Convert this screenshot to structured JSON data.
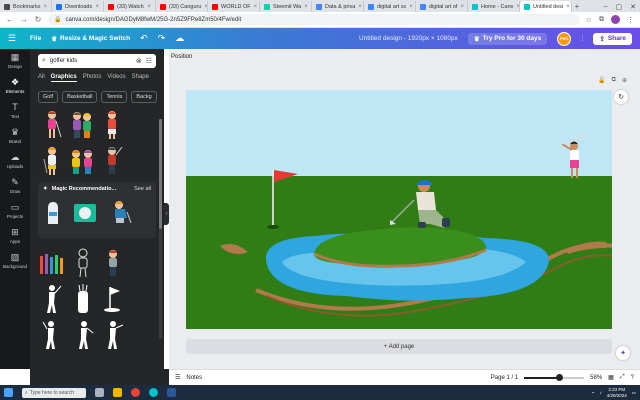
{
  "browser": {
    "tabs": [
      {
        "label": "Bookmarks",
        "color": "#4a4a4a"
      },
      {
        "label": "Downloads",
        "color": "#1a73e8"
      },
      {
        "label": "(33) Watch",
        "color": "#ff0000"
      },
      {
        "label": "(33) Canguru",
        "color": "#ff0000"
      },
      {
        "label": "WORLD OF",
        "color": "#ff0000"
      },
      {
        "label": "Steemit Wa",
        "color": "#06d6a9"
      },
      {
        "label": "Data & priva",
        "color": "#4285f4"
      },
      {
        "label": "digital art sc",
        "color": "#4285f4"
      },
      {
        "label": "digital art of",
        "color": "#4285f4"
      },
      {
        "label": "Home - Canv",
        "color": "#00c4cc"
      },
      {
        "label": "Untitled desi",
        "color": "#00c4cc",
        "active": true
      }
    ],
    "url": "canva.com/design/DAGDyM8fwM/25G-2n5Z9FPe8Zm50/4Fw/edit"
  },
  "header": {
    "file_label": "File",
    "resize_label": "Resize & Magic Switch",
    "title": "Untitled design - 1920px × 1080px",
    "trypro_label": "Try Pro for 30 days",
    "share_label": "Share",
    "avatar_text": "PRO"
  },
  "rail": [
    {
      "label": "Design",
      "icon": "▦"
    },
    {
      "label": "Elements",
      "icon": "❖",
      "active": true
    },
    {
      "label": "Text",
      "icon": "T"
    },
    {
      "label": "Brand",
      "icon": "♛"
    },
    {
      "label": "Uploads",
      "icon": "☁"
    },
    {
      "label": "Draw",
      "icon": "✎"
    },
    {
      "label": "Projects",
      "icon": "▭"
    },
    {
      "label": "Apps",
      "icon": "⊞"
    },
    {
      "label": "Background",
      "icon": "▨"
    }
  ],
  "panel": {
    "search_value": "golfer kids",
    "tabs": [
      "All",
      "Graphics",
      "Photos",
      "Videos",
      "Shape"
    ],
    "active_tab": "Graphics",
    "chips": [
      "Golf",
      "Basketball",
      "Tennis",
      "Backg"
    ],
    "magic_title": "Magic Recommendatio...",
    "magic_see_all": "See all"
  },
  "workspace": {
    "position_label": "Position",
    "add_page_label": "+ Add page"
  },
  "footer": {
    "notes_label": "Notes",
    "page_label": "Page 1 / 1",
    "zoom_label": "58%",
    "zoom_fraction": 0.58
  },
  "taskbar": {
    "search_placeholder": "Type here to search",
    "time": "2:23 PM",
    "date": "4/29/2024"
  },
  "colors": {
    "sky": "#bfe6f5",
    "grass": "#2f7d14",
    "water": "#2fa6e0",
    "panel": "#252627",
    "rail": "#18191b"
  }
}
